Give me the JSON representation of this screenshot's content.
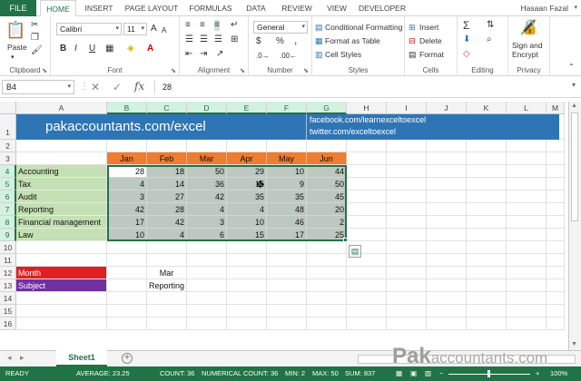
{
  "tabs": {
    "file": "FILE",
    "items": [
      "HOME",
      "INSERT",
      "PAGE LAYOUT",
      "FORMULAS",
      "DATA",
      "REVIEW",
      "VIEW",
      "DEVELOPER"
    ],
    "active": "HOME",
    "user": "Hasaan Fazal"
  },
  "ribbon": {
    "clipboard": {
      "label": "Clipboard",
      "paste": "Paste"
    },
    "font": {
      "label": "Font",
      "name": "Calibri",
      "size": "11",
      "bold": "B",
      "italic": "I",
      "underline": "U",
      "grow": "A",
      "shrink": "A"
    },
    "alignment": {
      "label": "Alignment"
    },
    "number": {
      "label": "Number",
      "format": "General",
      "currency": "$",
      "percent": "%",
      "comma": ","
    },
    "styles": {
      "label": "Styles",
      "conditional": "Conditional Formatting",
      "table": "Format as Table",
      "cell": "Cell Styles"
    },
    "cells": {
      "label": "Cells",
      "insert": "Insert",
      "delete": "Delete",
      "format": "Format"
    },
    "editing": {
      "label": "Editing"
    },
    "privacy": {
      "label": "Privacy",
      "sign_line1": "Sign and",
      "sign_line2": "Encrypt"
    }
  },
  "formula_bar": {
    "name_box": "B4",
    "value": "28"
  },
  "columns": [
    "A",
    "B",
    "C",
    "D",
    "E",
    "F",
    "G",
    "H",
    "I",
    "J",
    "K",
    "L",
    "M"
  ],
  "selected_columns": [
    "B",
    "C",
    "D",
    "E",
    "F",
    "G"
  ],
  "rows": [
    "1",
    "2",
    "3",
    "4",
    "5",
    "6",
    "7",
    "8",
    "9",
    "10",
    "11",
    "12",
    "13",
    "14",
    "15",
    "16"
  ],
  "selected_rows": [
    "4",
    "5",
    "6",
    "7",
    "8",
    "9"
  ],
  "banner": {
    "title": "pakaccountants.com/excel",
    "link1": "facebook.com/learnexceltoexcel",
    "link2": "twitter.com/exceltoexcel"
  },
  "table": {
    "months": [
      "Jan",
      "Feb",
      "Mar",
      "Apr",
      "May",
      "Jun"
    ],
    "subjects": [
      "Accounting",
      "Tax",
      "Audit",
      "Reporting",
      "Financial management",
      "Law"
    ],
    "values": [
      [
        28,
        18,
        50,
        29,
        10,
        44
      ],
      [
        4,
        14,
        36,
        15,
        9,
        50
      ],
      [
        3,
        27,
        42,
        35,
        35,
        45
      ],
      [
        42,
        28,
        4,
        4,
        48,
        20
      ],
      [
        17,
        42,
        3,
        10,
        46,
        2
      ],
      [
        10,
        4,
        6,
        15,
        17,
        25
      ]
    ]
  },
  "lookup": {
    "month_label": "Month",
    "month_value": "Mar",
    "subject_label": "Subject",
    "subject_value": "Reporting"
  },
  "sheets": [
    "Sheet1"
  ],
  "watermark": {
    "bold": "Pak",
    "rest": "accountants.com"
  },
  "status": {
    "ready": "READY",
    "average": "AVERAGE: 23.25",
    "count": "COUNT: 36",
    "numerical_count": "NUMERICAL COUNT: 36",
    "min": "MIN: 2",
    "max": "MAX: 50",
    "sum": "SUM: 837",
    "zoom": "100%"
  },
  "colors": {
    "excel_green": "#217346",
    "banner_blue": "#2e75b6",
    "header_orange": "#ed7d31",
    "label_green": "#c5e0b4",
    "month_red": "#e02020",
    "subject_purple": "#7030a0",
    "selection_fill": "#bcc8c0"
  }
}
